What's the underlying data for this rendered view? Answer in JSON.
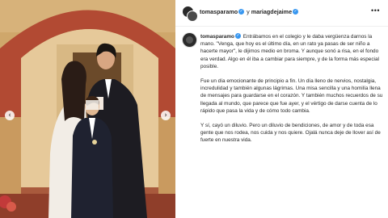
{
  "header": {
    "user1": "tomasparamo",
    "conjunction": "y",
    "user2": "mariagdejaime",
    "more_icon": "more-icon"
  },
  "post": {
    "username": "tomasparamo",
    "paragraphs": [
      "Entrábamos en el colegio y le daba vergüenza darnos la mano. \"Venga, que hoy es el último día, en un rato ya pasas de ser niño a hacerte mayor\", le dijimos medio en broma. Y aunque sonó a risa, en el fondo era verdad. Algo en él iba a cambiar para siempre, y de la forma más especial posible.",
      "Fue un día emocionante de principio a fin. Un día lleno de nervios, nostalgia, incredulidad y también algunas lágrimas. Una misa sencilla y una homilía llena de mensajes para guardarse en el corazón. Y también muchos recuerdos de su llegada al mundo, que parece que fue ayer, y el vértigo de darse cuenta de lo rápido que pasa la vida y de cómo todo cambia.",
      "Y sí, cayó un diluvio. Pero un diluvio de bendiciones, de amor y de toda esa gente que nos rodea, nos cuida y nos quiere. Ojalá nunca deje de llover así de fuerte en nuestra vida."
    ]
  },
  "photo": {
    "prev_icon": "chevron-left-icon",
    "next_icon": "chevron-right-icon",
    "prev_glyph": "‹",
    "next_glyph": "›"
  },
  "colors": {
    "accent": "#3897f0",
    "text": "#262626"
  }
}
